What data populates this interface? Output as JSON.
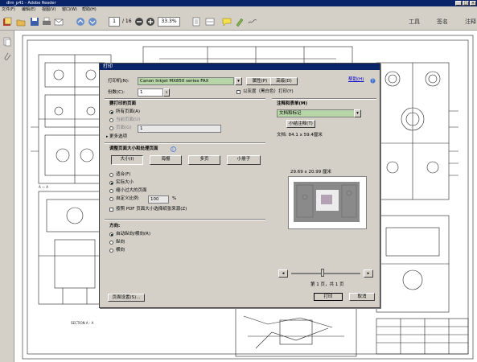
{
  "window": {
    "title": "dim_p41 - Adobe Reader"
  },
  "menu": [
    "文件(F)",
    "编辑(E)",
    "视图(V)",
    "窗口(W)",
    "帮助(H)"
  ],
  "toolbar": {
    "page_current": "1",
    "page_total": "/ 16",
    "zoom": "33.3%",
    "right_links": [
      "工具",
      "签名",
      "注释"
    ]
  },
  "dialog": {
    "title": "打印",
    "printer_label": "打印机(N):",
    "printer_value": "Canon Inkjet MX850 series FAX",
    "properties_button": "属性(P)",
    "advanced_button": "高级(D)",
    "help_link": "帮助(H)",
    "copies_label": "份数(C):",
    "copies_value": "1",
    "grayscale_label": "以灰度（黑白色）打印(Y)",
    "pages_section": "要打印的页面",
    "pages_all": "所有页面(A)",
    "pages_current": "当前页面(U)",
    "pages_range": "页面(G)",
    "pages_range_value": "1",
    "more_options": "更多选项",
    "sizing_section": "调整页面大小和处理页面",
    "tabs": [
      "大小(I)",
      "海报",
      "多页",
      "小册子"
    ],
    "fit": "适合(F)",
    "actual_size": "实际大小",
    "shrink_oversized": "缩小过大的页面",
    "custom_scale": "自定义比例:",
    "custom_scale_value": "100",
    "custom_scale_unit": "%",
    "choose_paper_by_pdf": "按照 PDF 页面大小选择纸张来源(Z)",
    "orientation_section": "方向:",
    "orientation_auto": "自动纵向/横向(R)",
    "orientation_portrait": "纵向",
    "orientation_landscape": "横向",
    "comments_section": "注释和表单(M)",
    "comments_value": "文档和标记",
    "summarize_button": "小结注释(T)",
    "doc_size": "文档: 84.1 x 59.4厘米",
    "preview_size": "29.69 x 20.99 厘米",
    "page_indicator": "第 1 页，共 1 页",
    "page_setup_button": "页面设置(S)...",
    "print_button": "打印",
    "cancel_button": "取消"
  },
  "drawing": {
    "section_label": "SECTION  A - A",
    "section_mark": "A — A"
  }
}
